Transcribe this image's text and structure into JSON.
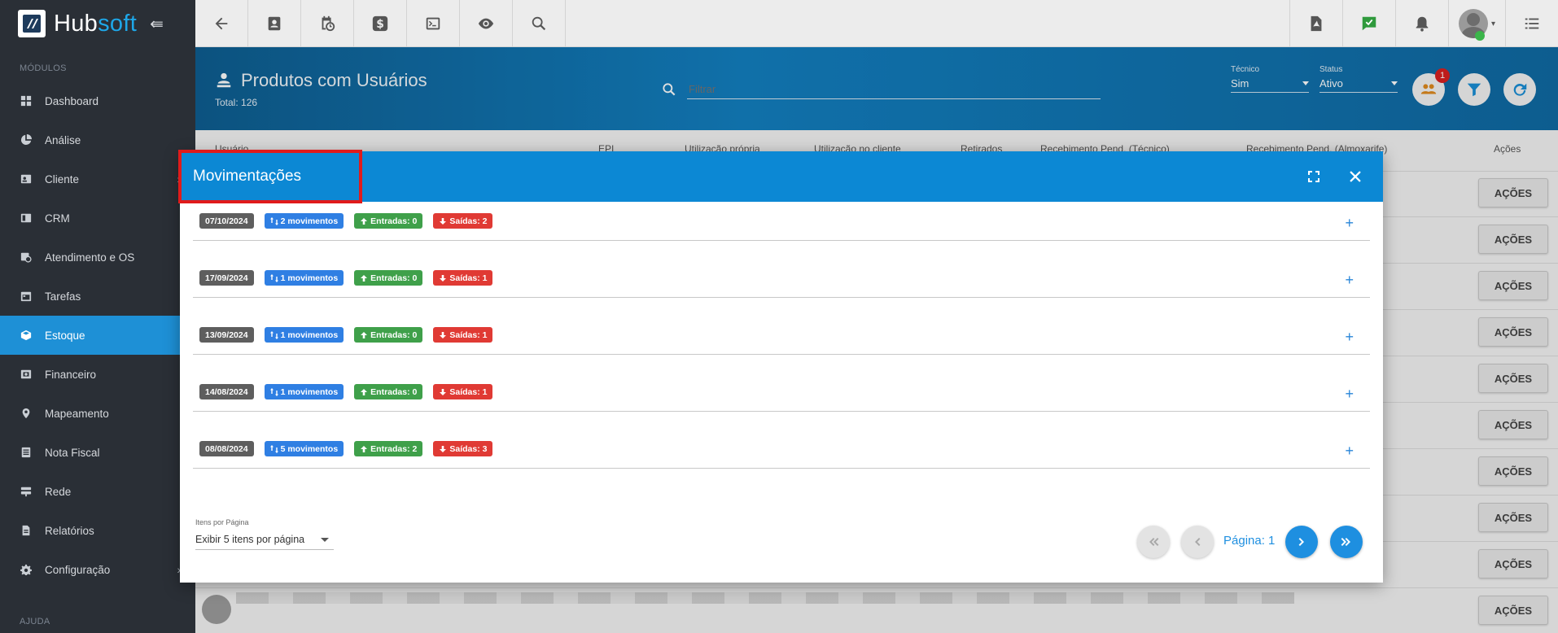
{
  "brand": {
    "name_a": "Hub",
    "name_b": "soft"
  },
  "sidebar": {
    "section_modules": "MÓDULOS",
    "section_help": "AJUDA",
    "items": [
      {
        "label": "Dashboard",
        "icon": "dashboard-icon"
      },
      {
        "label": "Análise",
        "icon": "pie-chart-icon"
      },
      {
        "label": "Cliente",
        "icon": "contact-card-icon",
        "has_children": true
      },
      {
        "label": "CRM",
        "icon": "crm-icon"
      },
      {
        "label": "Atendimento e OS",
        "icon": "calendar-clock-icon"
      },
      {
        "label": "Tarefas",
        "icon": "calendar-icon"
      },
      {
        "label": "Estoque",
        "icon": "box-icon",
        "active": true
      },
      {
        "label": "Financeiro",
        "icon": "money-icon"
      },
      {
        "label": "Mapeamento",
        "icon": "map-pin-icon"
      },
      {
        "label": "Nota Fiscal",
        "icon": "invoice-icon"
      },
      {
        "label": "Rede",
        "icon": "server-icon"
      },
      {
        "label": "Relatórios",
        "icon": "report-icon"
      },
      {
        "label": "Configuração",
        "icon": "gear-icon",
        "has_children": true
      }
    ]
  },
  "header": {
    "title": "Produtos com Usuários",
    "total": "Total: 126",
    "filter_placeholder": "Filtrar",
    "tecnico_label": "Técnico",
    "tecnico_value": "Sim",
    "status_label": "Status",
    "status_value": "Ativo",
    "notification_count": "1"
  },
  "table": {
    "columns": [
      "Usuário",
      "EPI",
      "Utilização própria",
      "Utilização no cliente",
      "Retirados",
      "Recebimento Pend. (Técnico)",
      "Recebimento Pend. (Almoxarife)",
      "Ações"
    ],
    "action_label": "AÇÕES"
  },
  "modal": {
    "title": "Movimentações",
    "rows": [
      {
        "date": "07/10/2024",
        "movimentos": "2 movimentos",
        "entradas": "Entradas: 0",
        "saidas": "Saídas: 2"
      },
      {
        "date": "17/09/2024",
        "movimentos": "1 movimentos",
        "entradas": "Entradas: 0",
        "saidas": "Saídas: 1"
      },
      {
        "date": "13/09/2024",
        "movimentos": "1 movimentos",
        "entradas": "Entradas: 0",
        "saidas": "Saídas: 1"
      },
      {
        "date": "14/08/2024",
        "movimentos": "1 movimentos",
        "entradas": "Entradas: 0",
        "saidas": "Saídas: 1"
      },
      {
        "date": "08/08/2024",
        "movimentos": "5 movimentos",
        "entradas": "Entradas: 2",
        "saidas": "Saídas: 3"
      }
    ],
    "per_page_label": "Itens por Página",
    "per_page_value": "Exibir 5 itens por página",
    "page_label": "Página: 1"
  }
}
